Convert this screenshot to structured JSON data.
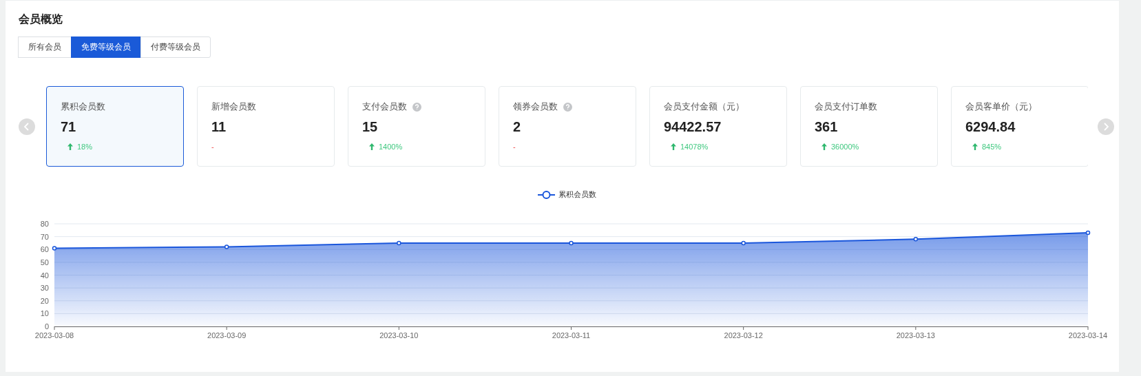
{
  "title": "会员概览",
  "tabs": [
    {
      "label": "所有会员",
      "selected": false
    },
    {
      "label": "免费等级会员",
      "selected": true
    },
    {
      "label": "付费等级会员",
      "selected": false
    }
  ],
  "cards": [
    {
      "label": "累积会员数",
      "value": "71",
      "kind": "up",
      "change": "18%",
      "help": false,
      "selected": true
    },
    {
      "label": "新增会员数",
      "value": "11",
      "kind": "none",
      "change": "-",
      "help": false,
      "selected": false
    },
    {
      "label": "支付会员数",
      "value": "15",
      "kind": "up",
      "change": "1400%",
      "help": true,
      "selected": false
    },
    {
      "label": "领券会员数",
      "value": "2",
      "kind": "none",
      "change": "-",
      "help": true,
      "selected": false
    },
    {
      "label": "会员支付金额（元）",
      "value": "94422.57",
      "kind": "up",
      "change": "14078%",
      "help": false,
      "selected": false
    },
    {
      "label": "会员支付订单数",
      "value": "361",
      "kind": "up",
      "change": "36000%",
      "help": false,
      "selected": false
    },
    {
      "label": "会员客单价（元）",
      "value": "6294.84",
      "kind": "up",
      "change": "845%",
      "help": false,
      "selected": false
    }
  ],
  "chart": {
    "chart_data": {
      "type": "area",
      "categories": [
        "2023-03-08",
        "2023-03-09",
        "2023-03-10",
        "2023-03-11",
        "2023-03-12",
        "2023-03-13",
        "2023-03-14"
      ],
      "series": [
        {
          "name": "累积会员数",
          "color": "#1a56db",
          "values": [
            61,
            62,
            65,
            65,
            65,
            68,
            73
          ]
        }
      ],
      "ylim": [
        0,
        80
      ],
      "grid": true,
      "yticks": [
        0,
        10,
        20,
        30,
        40,
        50,
        60,
        70,
        80
      ]
    }
  }
}
